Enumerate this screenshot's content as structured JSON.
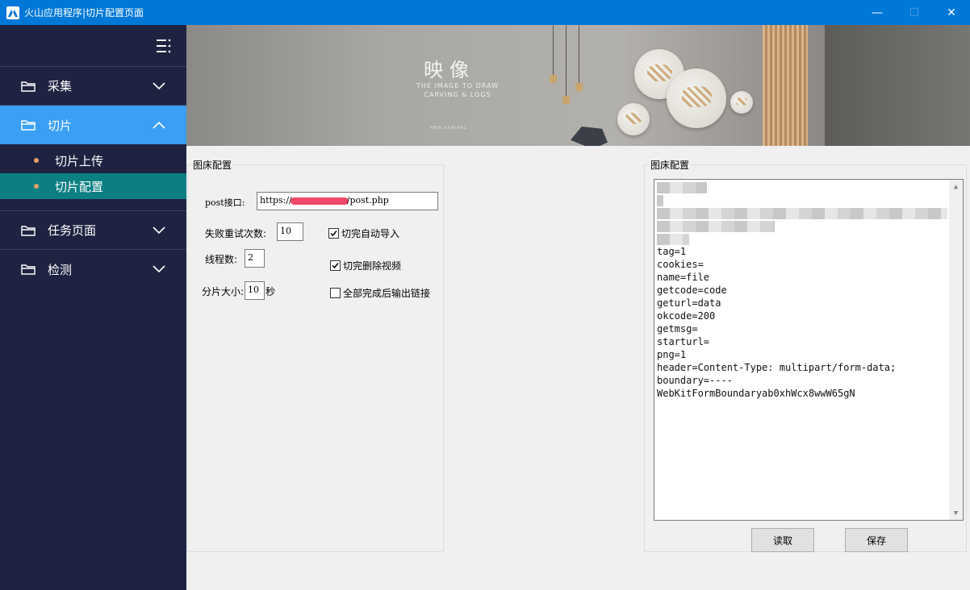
{
  "window": {
    "title": "火山应用程序|切片配置页面",
    "minimize": "—",
    "maximize": "☐",
    "close": "✕"
  },
  "sidebar": {
    "toggle_icon": "menu-icon",
    "items": [
      {
        "label": "采集",
        "expanded": false
      },
      {
        "label": "切片",
        "expanded": true,
        "children": [
          "切片上传",
          "切片配置"
        ],
        "selected_child": "切片配置"
      },
      {
        "label": "任务页面",
        "expanded": false
      },
      {
        "label": "检测",
        "expanded": false
      }
    ],
    "colors": {
      "bg": "#1f2341",
      "active": "#3a9ff5",
      "selected": "#0c7f83",
      "dot": "#e8a26a"
    }
  },
  "banner": {
    "title": "映像",
    "subtitle_line1": "THE IMAGE TO DRAW",
    "subtitle_line2": "CARVING & LOGS",
    "small": "NEW ARRIVAL"
  },
  "left_panel": {
    "legend": "图床配置",
    "post_label": "post接口:",
    "post_prefix": "https://",
    "post_suffix": "/post.php",
    "retry_label": "失败重试次数:",
    "retry_value": "10",
    "threads_label": "线程数:",
    "threads_value": "2",
    "slice_size_label": "分片大小:",
    "slice_size_value": "10",
    "slice_size_unit": "秒",
    "checkboxes": [
      {
        "label": "切完自动导入",
        "checked": true
      },
      {
        "label": "切完删除视频",
        "checked": true
      },
      {
        "label": "全部完成后输出链接",
        "checked": false
      }
    ]
  },
  "right_panel": {
    "legend": "图床配置",
    "config_lines": [
      "tag=1",
      "cookies=",
      "name=file",
      "getcode=code",
      "geturl=data",
      "okcode=200",
      "getmsg=",
      "starturl=",
      "png=1",
      "header=Content-Type: multipart/form-data;",
      "boundary=----",
      "WebKitFormBoundaryab0xhWcx8wwW65gN"
    ],
    "read_button": "读取",
    "save_button": "保存"
  }
}
